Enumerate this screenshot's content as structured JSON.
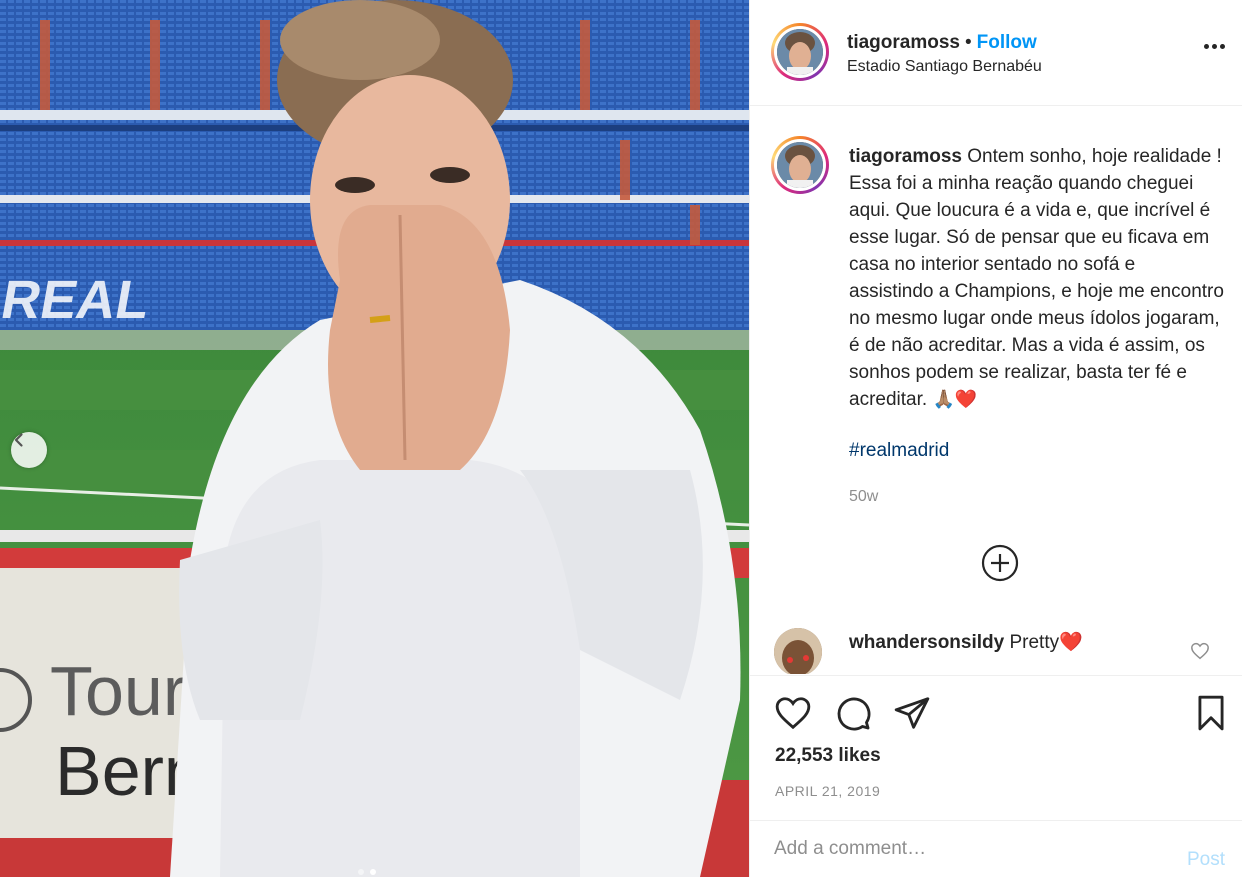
{
  "post": {
    "username": "tiagoramoss",
    "follow_label": "Follow",
    "separator": "•",
    "location": "Estadio Santiago Bernabéu",
    "caption_text": "Ontem sonho, hoje realidade ! Essa foi a minha reação quando cheguei aqui. Que loucura é a vida e, que incrível é esse lugar. Só de pensar que eu ficava em casa no interior sentado no sofá e assistindo a Champions, e hoje me encontro no mesmo lugar onde meus ídolos jogaram, é de não acreditar. Mas a vida é assim, os sonhos podem se realizar, basta ter fé e acreditar.",
    "caption_emojis": "🙏🏽❤️",
    "hashtag": "#realmadrid",
    "age": "50w",
    "likes": "22,553 likes",
    "date": "APRIL 21, 2019"
  },
  "photo": {
    "stadium_sign_text": "REAL",
    "banner_line1": "Tour",
    "banner_line2": "Bernab",
    "slide_count": 2,
    "active_slide": 1
  },
  "comments": [
    {
      "username": "whandersonsildy",
      "text": "Pretty",
      "emoji": "❤️"
    }
  ],
  "comment_box": {
    "placeholder": "Add a comment…",
    "post_label": "Post"
  },
  "icons": {
    "prev": "chevron-left-icon",
    "more": "more-options-icon",
    "load_more": "plus-circle-icon",
    "like": "heart-icon",
    "comment": "comment-icon",
    "share": "send-icon",
    "save": "bookmark-icon"
  },
  "colors": {
    "follow": "#0095f6",
    "hashtag": "#00376b",
    "muted": "#8e8e8e",
    "post_disabled": "#b2dffc"
  }
}
